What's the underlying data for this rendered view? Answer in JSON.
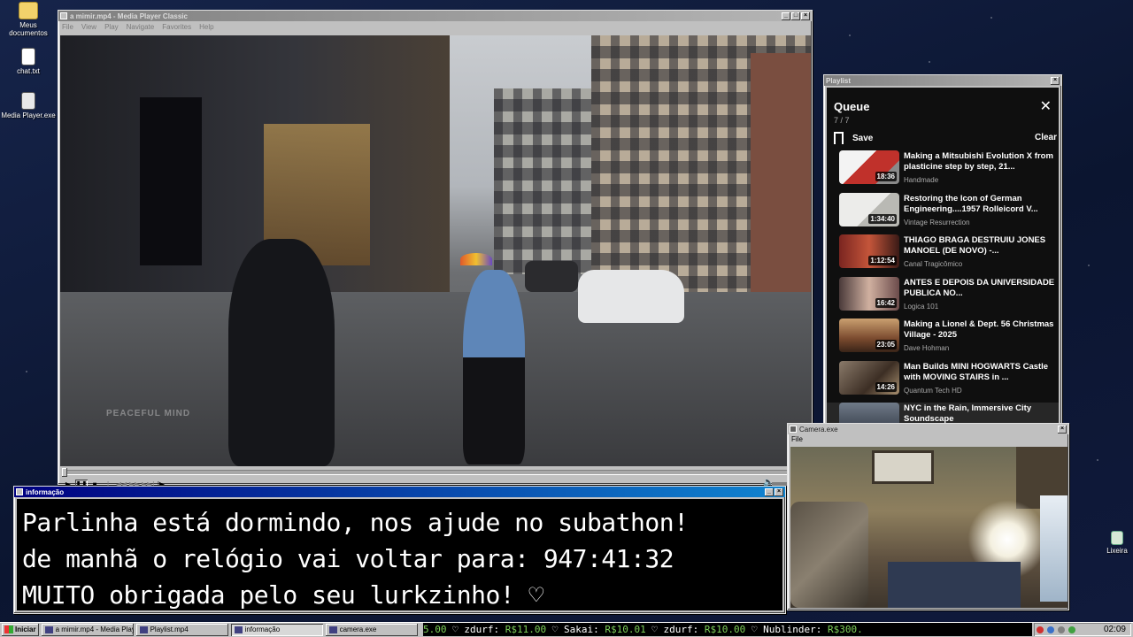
{
  "desktop": {
    "icons": [
      {
        "label": "Meus documentos",
        "icon": "folder-icon"
      },
      {
        "label": "chat.txt",
        "icon": "text-file-icon"
      },
      {
        "label": "Media Player.exe",
        "icon": "media-player-icon"
      },
      {
        "label": "Lixeira",
        "icon": "recycle-bin-icon"
      }
    ]
  },
  "media_player": {
    "title": "a mimir.mp4 - Media Player Classic",
    "menu": [
      "File",
      "View",
      "Play",
      "Navigate",
      "Favorites",
      "Help"
    ],
    "video_watermark": "PEACEFUL MIND",
    "seek_progress": 0.0,
    "controls": [
      {
        "name": "play-button",
        "glyph": "▶"
      },
      {
        "name": "pause-button",
        "glyph": "❚❚"
      },
      {
        "name": "stop-button",
        "glyph": "■"
      },
      {
        "name": "prev-button",
        "glyph": "|◀◀"
      },
      {
        "name": "rewind-button",
        "glyph": "◀◀"
      },
      {
        "name": "forward-button",
        "glyph": "▶▶"
      },
      {
        "name": "next-button",
        "glyph": "▶▶|"
      },
      {
        "name": "frame-step-button",
        "glyph": "|▶"
      }
    ]
  },
  "info_window": {
    "title": "informação",
    "lines": [
      "Parlinha está dormindo, nos ajude no subathon!",
      "de manhã o relógio vai voltar para:  947:41:32",
      "MUITO obrigada pelo seu lurkzinho! ♡"
    ]
  },
  "playlist_window": {
    "title": "Playlist",
    "queue_title": "Queue",
    "queue_count": "7 / 7",
    "save_label": "Save",
    "clear_label": "Clear",
    "items": [
      {
        "title": "Making a Mitsubishi Evolution X from plasticine step by step, 21...",
        "channel": "Handmade",
        "duration": "18:36",
        "thumb_color": "#b8463e"
      },
      {
        "title": "Restoring the Icon of German Engineering....1957 Rolleicord V...",
        "channel": "Vintage Resurrection",
        "duration": "1:34:40",
        "thumb_color": "#d9d9d6"
      },
      {
        "title": "THIAGO BRAGA DESTRUIU JONES MANOEL (DE NOVO) -...",
        "channel": "Canal Tragicômico",
        "duration": "1:12:54",
        "thumb_color": "#8a2a24"
      },
      {
        "title": "ANTES E DEPOIS DA UNIVERSIDADE PUBLICA NO...",
        "channel": "Logica 101",
        "duration": "16:42",
        "thumb_color": "#6b4b4b"
      },
      {
        "title": "Making a Lionel & Dept. 56 Christmas Village - 2025",
        "channel": "Dave Hohman",
        "duration": "23:05",
        "thumb_color": "#7a4a2e"
      },
      {
        "title": "Man Builds MINI HOGWARTS Castle with MOVING STAIRS in ...",
        "channel": "Quantum Tech HD",
        "duration": "14:26",
        "thumb_color": "#5b4a3c"
      },
      {
        "title": "NYC in the Rain, Immersive City Soundscape",
        "channel": "",
        "duration": "",
        "thumb_color": "#4a5566"
      }
    ]
  },
  "camera_window": {
    "title": "Camera.exe",
    "menu": [
      "File"
    ]
  },
  "taskbar": {
    "start_label": "Iniciar",
    "tasks": [
      {
        "label": "a mimir.mp4 - Media Playe...",
        "active": false
      },
      {
        "label": "Playlist.mp4",
        "active": false
      },
      {
        "label": "informação",
        "active": true
      },
      {
        "label": "camera.exe",
        "active": false
      }
    ],
    "ticker": [
      {
        "prefix": "",
        "amount": "5.00"
      },
      {
        "prefix": "  ♡  zdurf: ",
        "amount": "R$11.00"
      },
      {
        "prefix": "  ♡  Sakai: ",
        "amount": "R$10.01"
      },
      {
        "prefix": "  ♡  zdurf: ",
        "amount": "R$10.00"
      },
      {
        "prefix": "  ♡  Nublinder: ",
        "amount": "R$300."
      }
    ],
    "clock": "02:09"
  }
}
